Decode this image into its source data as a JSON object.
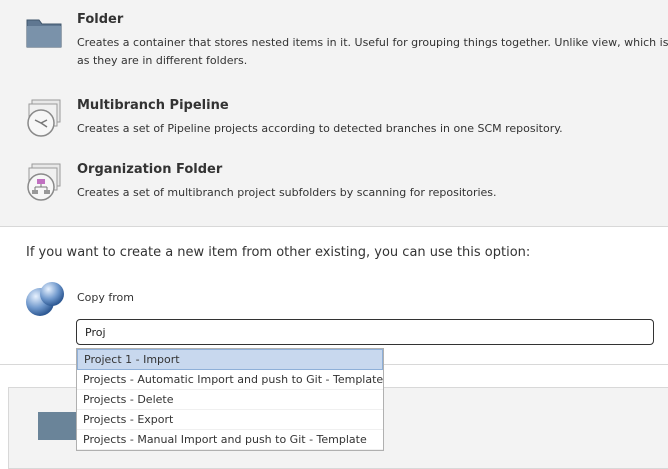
{
  "items": [
    {
      "title": "Folder",
      "description": "Creates a container that stores nested items in it. Useful for grouping things together. Unlike view, which is just",
      "description_cont": "as they are in different folders."
    },
    {
      "title": "Multibranch Pipeline",
      "description": "Creates a set of Pipeline projects according to detected branches in one SCM repository."
    },
    {
      "title": "Organization Folder",
      "description": "Creates a set of multibranch project subfolders by scanning for repositories."
    }
  ],
  "copy": {
    "prompt": "If you want to create a new item from other existing, you can use this option:",
    "label": "Copy from",
    "input_value": "Proj"
  },
  "autocomplete": {
    "options": [
      "Project 1 - Import",
      "Projects - Automatic Import and push to Git - Template",
      "Projects - Delete",
      "Projects - Export",
      "Projects - Manual Import and push to Git - Template"
    ],
    "selected_option": "Project 1 - Import"
  }
}
